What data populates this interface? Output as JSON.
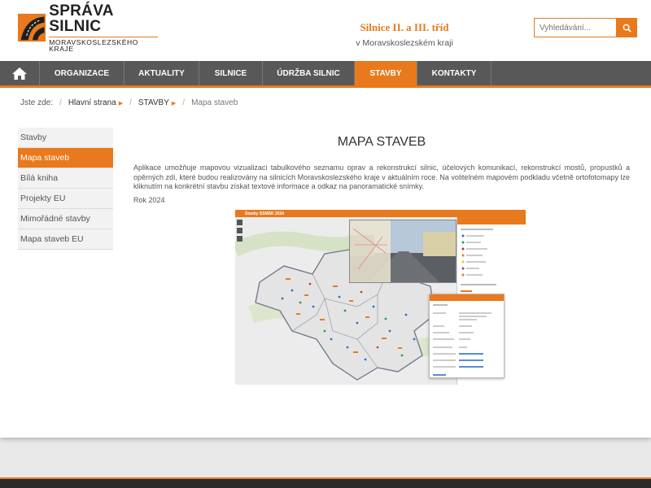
{
  "header": {
    "logo_title": "SPRÁVA SILNIC",
    "logo_subtitle": "MORAVSKOSLEZSKÉHO KRAJE",
    "tagline_main": "Silnice II. a III. tříd",
    "tagline_sub": "v Moravskoslezském kraji",
    "search_placeholder": "Vyhledávání...",
    "search_icon": "search-icon"
  },
  "nav": {
    "home_icon": "home-icon",
    "items": [
      {
        "label": "ORGANIZACE"
      },
      {
        "label": "AKTUALITY"
      },
      {
        "label": "SILNICE"
      },
      {
        "label": "ÚDRŽBA SILNIC"
      },
      {
        "label": "STAVBY",
        "active": true
      },
      {
        "label": "KONTAKTY"
      }
    ]
  },
  "breadcrumb": {
    "prefix": "Jste zde:",
    "items": [
      "Hlavní strana",
      "STAVBY"
    ],
    "current": "Mapa staveb"
  },
  "sidebar": {
    "items": [
      {
        "label": "Stavby"
      },
      {
        "label": "Mapa staveb",
        "active": true
      },
      {
        "label": "Bílá kniha"
      },
      {
        "label": "Projekty EU"
      },
      {
        "label": "Mimořádné stavby"
      },
      {
        "label": "Mapa staveb EU"
      }
    ]
  },
  "content": {
    "title": "MAPA STAVEB",
    "paragraph": "Aplikace umožňuje mapovou vizualizaci tabulkového seznamu oprav a rekonstrukcí silnic, účelových komunikací, rekonstrukcí mostů, propustků a opěrných zdí, které budou realizovány na silnicích Moravskoslezského kraje v aktuálním roce. Na volitelném mapovém podkladu včetně ortofotomapy lze kliknutím na konkrétní stavbu získat textové informace a odkaz na panoramatické snímky.",
    "year": "Rok 2024"
  },
  "map_app": {
    "title": "Stavby SSMSK 2024"
  },
  "colors": {
    "accent": "#e8791d",
    "nav_bg": "#585858"
  }
}
